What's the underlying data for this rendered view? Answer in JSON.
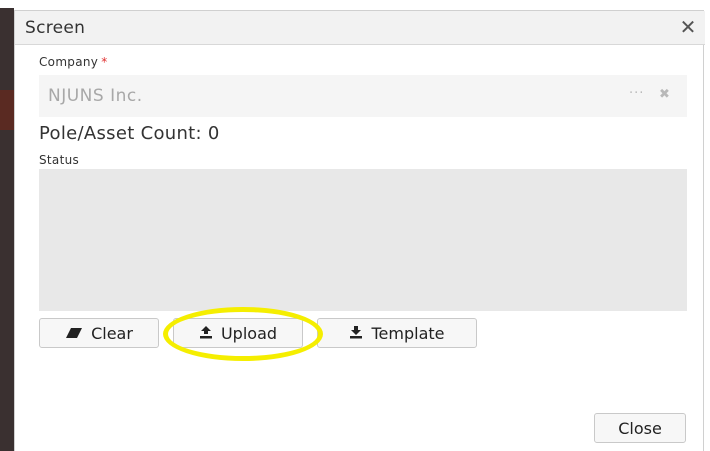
{
  "dialog": {
    "title": "Screen",
    "close_icon": "close-icon"
  },
  "company": {
    "label": "Company",
    "required_mark": "*",
    "value": "NJUNS Inc.",
    "more_icon": "ellipsis-icon",
    "clear_icon": "clear-x-icon"
  },
  "count": {
    "text": "Pole/Asset Count: 0"
  },
  "status": {
    "label": "Status",
    "value": ""
  },
  "buttons": {
    "clear_label": "Clear",
    "clear_icon": "eraser-icon",
    "upload_label": "Upload",
    "upload_icon": "upload-icon",
    "template_label": "Template",
    "template_icon": "download-icon",
    "close_label": "Close"
  },
  "colors": {
    "highlight": "#f5ee00",
    "required": "#e03030"
  }
}
